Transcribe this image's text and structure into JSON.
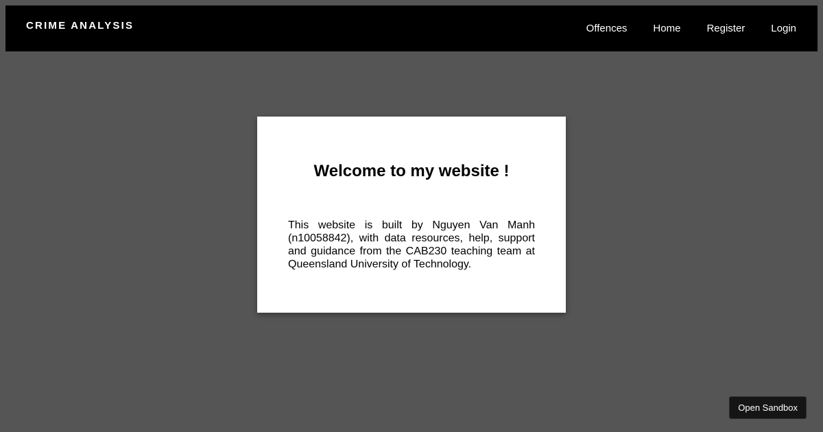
{
  "navbar": {
    "brand": "CRIME ANALYSIS",
    "links": [
      {
        "label": "Offences"
      },
      {
        "label": "Home"
      },
      {
        "label": "Register"
      },
      {
        "label": "Login"
      }
    ]
  },
  "card": {
    "title": "Welcome to my website !",
    "body": "This website is built by Nguyen Van Manh (n10058842), with data resources, help, support and guidance from the CAB230 teaching team at Queensland University of Technology."
  },
  "sandbox": {
    "label": "Open Sandbox"
  },
  "colors": {
    "background": "#555555",
    "navbar": "#000000",
    "card": "#ffffff",
    "sandbox_button": "#151515"
  }
}
